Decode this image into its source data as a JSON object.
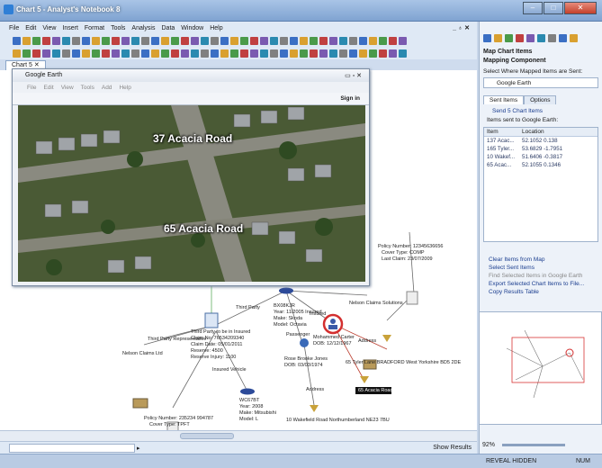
{
  "window": {
    "title": "Chart 5 - Analyst's Notebook 8"
  },
  "menu": [
    "File",
    "Edit",
    "View",
    "Insert",
    "Format",
    "Tools",
    "Analysis",
    "Data",
    "Window",
    "Help"
  ],
  "doc_tab": "Chart 5",
  "google_earth": {
    "title": "Google Earth",
    "menu": [
      "File",
      "Edit",
      "View",
      "Tools",
      "Add",
      "Help"
    ],
    "sign_in": "Sign in",
    "placemarks": [
      "37 Acacia Road",
      "65 Acacia Road"
    ]
  },
  "chart": {
    "nodes": {
      "policy1": {
        "title": "Policy Number: 12345636656",
        "l1": "Cover Type: COMP",
        "l2": "Last Claim: 23/07/2009"
      },
      "nelson1": "Nelson Claims Solutions",
      "third_party": "Third Party",
      "vehicle1": {
        "title": "BX08KJR",
        "l1": "Year: 11/2005 Insured",
        "l2": "Make: Skoda",
        "l3": "Model: Octavia"
      },
      "insured": "Insured",
      "claim": {
        "title": "Third Party to be in Insured",
        "l1": "Claim No: 76534209340",
        "l2": "Claim Date: 05/01/2011",
        "l3": "Reserve: 4500",
        "l4": "Reserve Injury: 1100"
      },
      "third_party_rep": "Third Party Representative",
      "nelson2": "Nelson Claims Ltd",
      "mohammed": {
        "title": "Mohammed Carter",
        "l1": "DOB: 12/12/1967"
      },
      "passenger": "Passenger",
      "rose": {
        "title": "Rose Brooke Jones",
        "l1": "DOB: 03/03/1974"
      },
      "address1": "Address",
      "address2": "Address",
      "addr_full": "65 Tyler Lane BRADFORD West Yorkshire BD5 2DE",
      "acacia_box": "65 Acacia Road",
      "insured_vehicle": "Insured Vehicle",
      "vehicle2": {
        "title": "WC67BT",
        "l1": "Year: 2008",
        "l2": "Make: Mitsubishi",
        "l3": "Model: L"
      },
      "policy2": {
        "title": "Policy Number: 235234 994787",
        "l1": "Cover Type: TPFT"
      },
      "street": "10 Wakefield Road Northumberland NE23 7BU"
    }
  },
  "right_pane": {
    "title": "Map Chart Items",
    "subtitle": "Mapping Component",
    "select_label": "Select Where Mapped Items are Sent:",
    "select_value": "Google Earth",
    "tabs": [
      "Sent Items",
      "Options"
    ],
    "send_link": "Send 5 Chart Items",
    "sent_text": "Items sent to Google Earth:",
    "columns": [
      "Item",
      "Location"
    ],
    "rows": [
      {
        "item": "137 Acac...",
        "loc": "52.1052 0.138"
      },
      {
        "item": "165 Tyler...",
        "loc": "53.6829 -1.7951"
      },
      {
        "item": "10 Wakef...",
        "loc": "51.6406 -0.3817"
      },
      {
        "item": "65 Acac...",
        "loc": "52.1055 0.1346"
      }
    ],
    "actions": [
      "Clear Items from Map",
      "Select Sent Items",
      "Find Selected Items in Google Earth",
      "Export Selected Chart Items to File...",
      "Copy Results Table"
    ]
  },
  "status": {
    "show_results": "Show Results",
    "zoom": "92%"
  },
  "footer": {
    "left": "REVEAL HIDDEN",
    "right": "NUM"
  }
}
